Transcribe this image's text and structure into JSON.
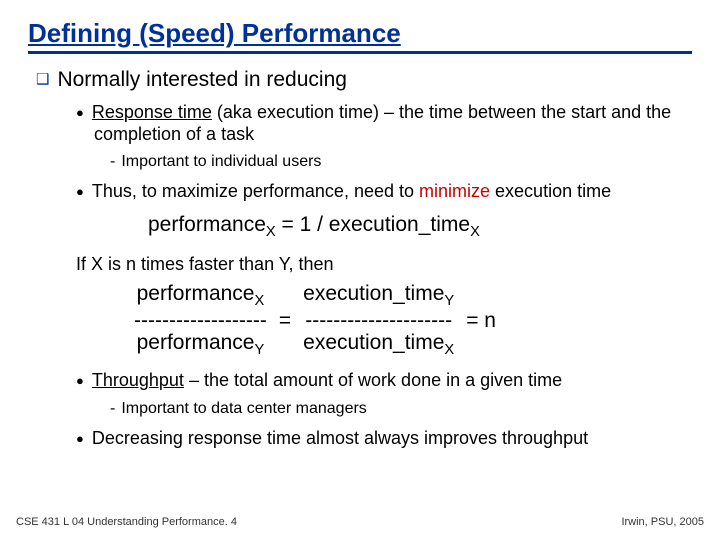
{
  "title": "Defining (Speed) Performance",
  "main_bullet": "Normally interested in reducing",
  "resp_time_a": "Response time",
  "resp_time_b": " (aka execution time) – the time between the start and the completion of a task",
  "resp_sub": "Important to individual users",
  "maximize_a": "Thus, to maximize performance, need to ",
  "maximize_b": "minimize",
  "maximize_c": " execution time",
  "formula1_a": "performance",
  "formula1_b": " = 1 / execution_time",
  "sub_x": "X",
  "sub_y": "Y",
  "faster_line": "If X is n times faster than Y, then",
  "ratio_perf": "performance",
  "ratio_dash1": "-------------------",
  "ratio_exec": "execution_time",
  "ratio_dash2": "---------------------",
  "ratio_eq": "=",
  "ratio_n": "= n",
  "throughput_a": "Throughput",
  "throughput_b": " – the total amount of work done in a given time",
  "throughput_sub": "Important to data center managers",
  "decrease": "Decreasing response time almost always improves throughput",
  "footer_left": "CSE 431  L 04 Understanding Performance. 4",
  "footer_right": "Irwin, PSU, 2005"
}
